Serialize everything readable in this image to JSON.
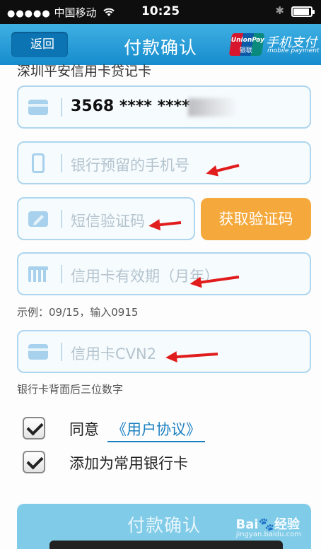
{
  "status_bar": {
    "signal": "●●●●●",
    "carrier": "中国移动",
    "wifi_icon": "wifi-icon",
    "time": "10:25",
    "bluetooth_icon": "bluetooth-icon",
    "battery_icon": "battery-icon"
  },
  "header": {
    "back_label": "返回",
    "title": "付款确认",
    "brand_logo_text": "UnionPay",
    "brand_logo_sub": "银联",
    "brand_title": "手机支付",
    "brand_subtitle": "mobile payment"
  },
  "bank_name": "深圳平安信用卡贷记卡",
  "card_number": {
    "icon": "card-icon",
    "value": "3568 **** ****"
  },
  "phone_field": {
    "icon": "phone-icon",
    "placeholder": "银行预留的手机号"
  },
  "sms_field": {
    "icon": "edit-icon",
    "placeholder": "短信验证码",
    "get_code_label": "获取验证码"
  },
  "expiry_field": {
    "icon": "calendar-icon",
    "placeholder": "信用卡有效期（月年）",
    "hint": "示例：09/15，输入0915"
  },
  "cvn_field": {
    "icon": "card-icon",
    "placeholder": "信用卡CVN2",
    "hint": "银行卡背面后三位数字"
  },
  "agree": {
    "checked": true,
    "label": "同意",
    "link": "《用户协议》"
  },
  "save_card": {
    "checked": true,
    "label": "添加为常用银行卡"
  },
  "submit_label": "付款确认",
  "watermark": {
    "text": "Bai🐾经验",
    "sub": "jingyan.baidu.com"
  },
  "colors": {
    "nav": "#1e9ad6",
    "field_border": "#aed6ee",
    "accent_button": "#f5a93c",
    "submit_button": "#7fcbe8",
    "link": "#1a7fc1",
    "annotation_arrow": "#e11c1c"
  }
}
